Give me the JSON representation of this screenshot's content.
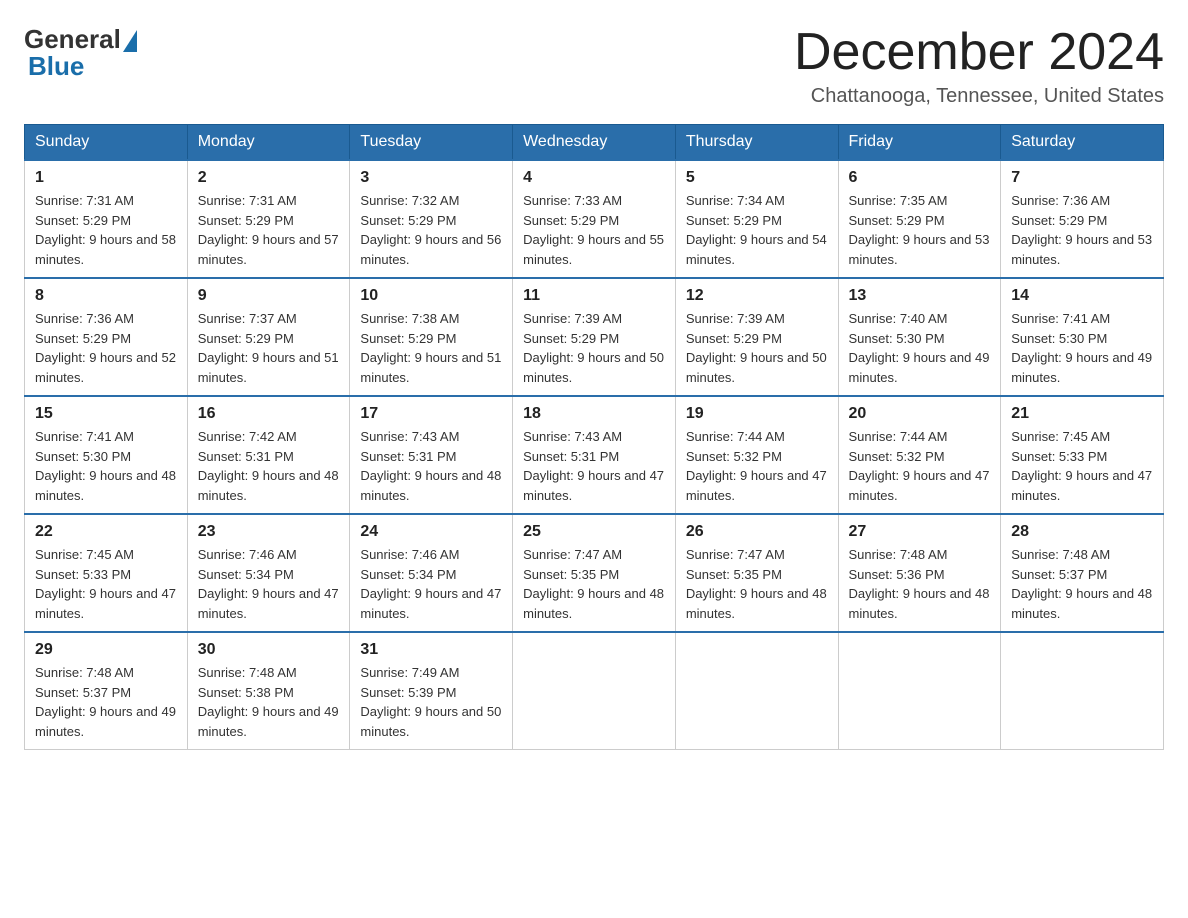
{
  "header": {
    "logo_general": "General",
    "logo_blue": "Blue",
    "month_title": "December 2024",
    "location": "Chattanooga, Tennessee, United States"
  },
  "days_of_week": [
    "Sunday",
    "Monday",
    "Tuesday",
    "Wednesday",
    "Thursday",
    "Friday",
    "Saturday"
  ],
  "weeks": [
    [
      {
        "day": "1",
        "sunrise": "7:31 AM",
        "sunset": "5:29 PM",
        "daylight": "9 hours and 58 minutes."
      },
      {
        "day": "2",
        "sunrise": "7:31 AM",
        "sunset": "5:29 PM",
        "daylight": "9 hours and 57 minutes."
      },
      {
        "day": "3",
        "sunrise": "7:32 AM",
        "sunset": "5:29 PM",
        "daylight": "9 hours and 56 minutes."
      },
      {
        "day": "4",
        "sunrise": "7:33 AM",
        "sunset": "5:29 PM",
        "daylight": "9 hours and 55 minutes."
      },
      {
        "day": "5",
        "sunrise": "7:34 AM",
        "sunset": "5:29 PM",
        "daylight": "9 hours and 54 minutes."
      },
      {
        "day": "6",
        "sunrise": "7:35 AM",
        "sunset": "5:29 PM",
        "daylight": "9 hours and 53 minutes."
      },
      {
        "day": "7",
        "sunrise": "7:36 AM",
        "sunset": "5:29 PM",
        "daylight": "9 hours and 53 minutes."
      }
    ],
    [
      {
        "day": "8",
        "sunrise": "7:36 AM",
        "sunset": "5:29 PM",
        "daylight": "9 hours and 52 minutes."
      },
      {
        "day": "9",
        "sunrise": "7:37 AM",
        "sunset": "5:29 PM",
        "daylight": "9 hours and 51 minutes."
      },
      {
        "day": "10",
        "sunrise": "7:38 AM",
        "sunset": "5:29 PM",
        "daylight": "9 hours and 51 minutes."
      },
      {
        "day": "11",
        "sunrise": "7:39 AM",
        "sunset": "5:29 PM",
        "daylight": "9 hours and 50 minutes."
      },
      {
        "day": "12",
        "sunrise": "7:39 AM",
        "sunset": "5:29 PM",
        "daylight": "9 hours and 50 minutes."
      },
      {
        "day": "13",
        "sunrise": "7:40 AM",
        "sunset": "5:30 PM",
        "daylight": "9 hours and 49 minutes."
      },
      {
        "day": "14",
        "sunrise": "7:41 AM",
        "sunset": "5:30 PM",
        "daylight": "9 hours and 49 minutes."
      }
    ],
    [
      {
        "day": "15",
        "sunrise": "7:41 AM",
        "sunset": "5:30 PM",
        "daylight": "9 hours and 48 minutes."
      },
      {
        "day": "16",
        "sunrise": "7:42 AM",
        "sunset": "5:31 PM",
        "daylight": "9 hours and 48 minutes."
      },
      {
        "day": "17",
        "sunrise": "7:43 AM",
        "sunset": "5:31 PM",
        "daylight": "9 hours and 48 minutes."
      },
      {
        "day": "18",
        "sunrise": "7:43 AM",
        "sunset": "5:31 PM",
        "daylight": "9 hours and 47 minutes."
      },
      {
        "day": "19",
        "sunrise": "7:44 AM",
        "sunset": "5:32 PM",
        "daylight": "9 hours and 47 minutes."
      },
      {
        "day": "20",
        "sunrise": "7:44 AM",
        "sunset": "5:32 PM",
        "daylight": "9 hours and 47 minutes."
      },
      {
        "day": "21",
        "sunrise": "7:45 AM",
        "sunset": "5:33 PM",
        "daylight": "9 hours and 47 minutes."
      }
    ],
    [
      {
        "day": "22",
        "sunrise": "7:45 AM",
        "sunset": "5:33 PM",
        "daylight": "9 hours and 47 minutes."
      },
      {
        "day": "23",
        "sunrise": "7:46 AM",
        "sunset": "5:34 PM",
        "daylight": "9 hours and 47 minutes."
      },
      {
        "day": "24",
        "sunrise": "7:46 AM",
        "sunset": "5:34 PM",
        "daylight": "9 hours and 47 minutes."
      },
      {
        "day": "25",
        "sunrise": "7:47 AM",
        "sunset": "5:35 PM",
        "daylight": "9 hours and 48 minutes."
      },
      {
        "day": "26",
        "sunrise": "7:47 AM",
        "sunset": "5:35 PM",
        "daylight": "9 hours and 48 minutes."
      },
      {
        "day": "27",
        "sunrise": "7:48 AM",
        "sunset": "5:36 PM",
        "daylight": "9 hours and 48 minutes."
      },
      {
        "day": "28",
        "sunrise": "7:48 AM",
        "sunset": "5:37 PM",
        "daylight": "9 hours and 48 minutes."
      }
    ],
    [
      {
        "day": "29",
        "sunrise": "7:48 AM",
        "sunset": "5:37 PM",
        "daylight": "9 hours and 49 minutes."
      },
      {
        "day": "30",
        "sunrise": "7:48 AM",
        "sunset": "5:38 PM",
        "daylight": "9 hours and 49 minutes."
      },
      {
        "day": "31",
        "sunrise": "7:49 AM",
        "sunset": "5:39 PM",
        "daylight": "9 hours and 50 minutes."
      },
      null,
      null,
      null,
      null
    ]
  ]
}
